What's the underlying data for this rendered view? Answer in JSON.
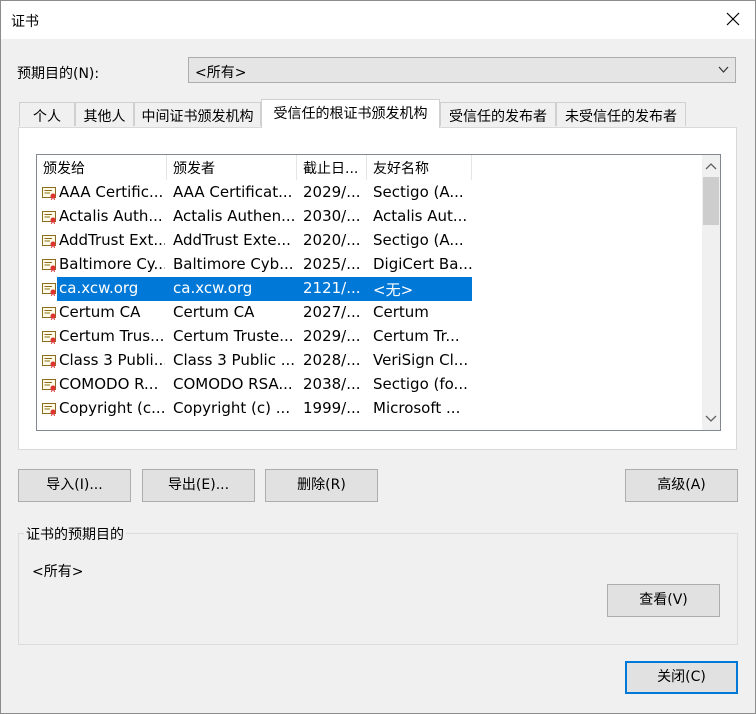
{
  "window": {
    "title": "证书",
    "close_icon": "close-icon"
  },
  "purpose": {
    "label": "预期目的(N):",
    "selected": "<所有>"
  },
  "tabs": [
    {
      "label": "个人"
    },
    {
      "label": "其他人"
    },
    {
      "label": "中间证书颁发机构"
    },
    {
      "label": "受信任的根证书颁发机构",
      "active": true
    },
    {
      "label": "受信任的发布者"
    },
    {
      "label": "未受信任的发布者"
    }
  ],
  "columns": [
    "颁发给",
    "颁发者",
    "截止日...",
    "友好名称"
  ],
  "rows": [
    [
      "AAA Certific...",
      "AAA Certificat...",
      "2029/...",
      "Sectigo (A..."
    ],
    [
      "Actalis Auth...",
      "Actalis Authen...",
      "2030/...",
      "Actalis Aut..."
    ],
    [
      "AddTrust Ext...",
      "AddTrust Exte...",
      "2020/...",
      "Sectigo (A..."
    ],
    [
      "Baltimore Cy...",
      "Baltimore Cyb...",
      "2025/...",
      "DigiCert Ba..."
    ],
    [
      "ca.xcw.org",
      "ca.xcw.org",
      "2121/...",
      "<无>"
    ],
    [
      "Certum CA",
      "Certum CA",
      "2027/...",
      "Certum"
    ],
    [
      "Certum Trus...",
      "Certum Truste...",
      "2029/...",
      "Certum Tr..."
    ],
    [
      "Class 3 Publi...",
      "Class 3 Public ...",
      "2028/...",
      "VeriSign Cl..."
    ],
    [
      "COMODO R...",
      "COMODO RSA...",
      "2038/...",
      "Sectigo (fo..."
    ],
    [
      "Copyright (c...",
      "Copyright (c) ...",
      "1999/...",
      "Microsoft ..."
    ]
  ],
  "selected_row": 4,
  "buttons": {
    "import": "导入(I)...",
    "export": "导出(E)...",
    "remove": "删除(R)",
    "advanced": "高级(A)",
    "view": "查看(V)",
    "close": "关闭(C)"
  },
  "purposes_group": {
    "title": "证书的预期目的",
    "value": "<所有>"
  },
  "colors": {
    "selection": "#0078d7",
    "default_border": "#0078d7"
  }
}
